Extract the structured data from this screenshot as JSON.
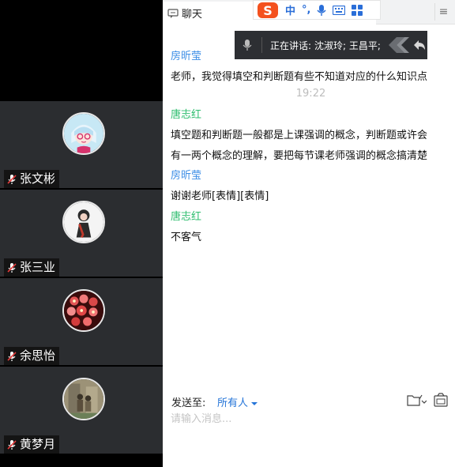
{
  "participants": [
    {
      "name": "张文彬",
      "avatar_bg": "#c7e8f5"
    },
    {
      "name": "张三业",
      "avatar_bg": "#f4f4f4"
    },
    {
      "name": "余思怡",
      "avatar_bg": "#5a1010"
    },
    {
      "name": "黄梦月",
      "avatar_bg": "#9c9277"
    }
  ],
  "chat": {
    "tab_title": "聊天",
    "speaking_label": "正在讲话:",
    "speaking_names": "沈淑玲; 王昌平;",
    "messages": [
      {
        "sender": "房昕莹",
        "sender_color": "#3c8ee6",
        "lines": [
          "老师，我觉得填空和判断题有些不知道对应的什么知识点"
        ]
      },
      {
        "time": "19:22"
      },
      {
        "sender": "唐志红",
        "sender_color": "#2dbd6e",
        "lines": [
          "填空题和判断题一般都是上课强调的概念，判断题或许会",
          "有一两个概念的理解，要把每节课老师强调的概念搞清楚"
        ]
      },
      {
        "sender": "房昕莹",
        "sender_color": "#3c8ee6",
        "lines": [
          "谢谢老师[表情][表情]"
        ]
      },
      {
        "sender": "唐志红",
        "sender_color": "#2dbd6e",
        "lines": [
          "不客气"
        ]
      }
    ],
    "composer": {
      "send_to_label": "发送至:",
      "send_to_value": "所有人",
      "placeholder": "请输入消息..."
    }
  },
  "ime": {
    "mode": "中",
    "punct": "°,"
  },
  "colors": {
    "accent": "#2474d8",
    "tile_bg": "#2b2d30"
  }
}
